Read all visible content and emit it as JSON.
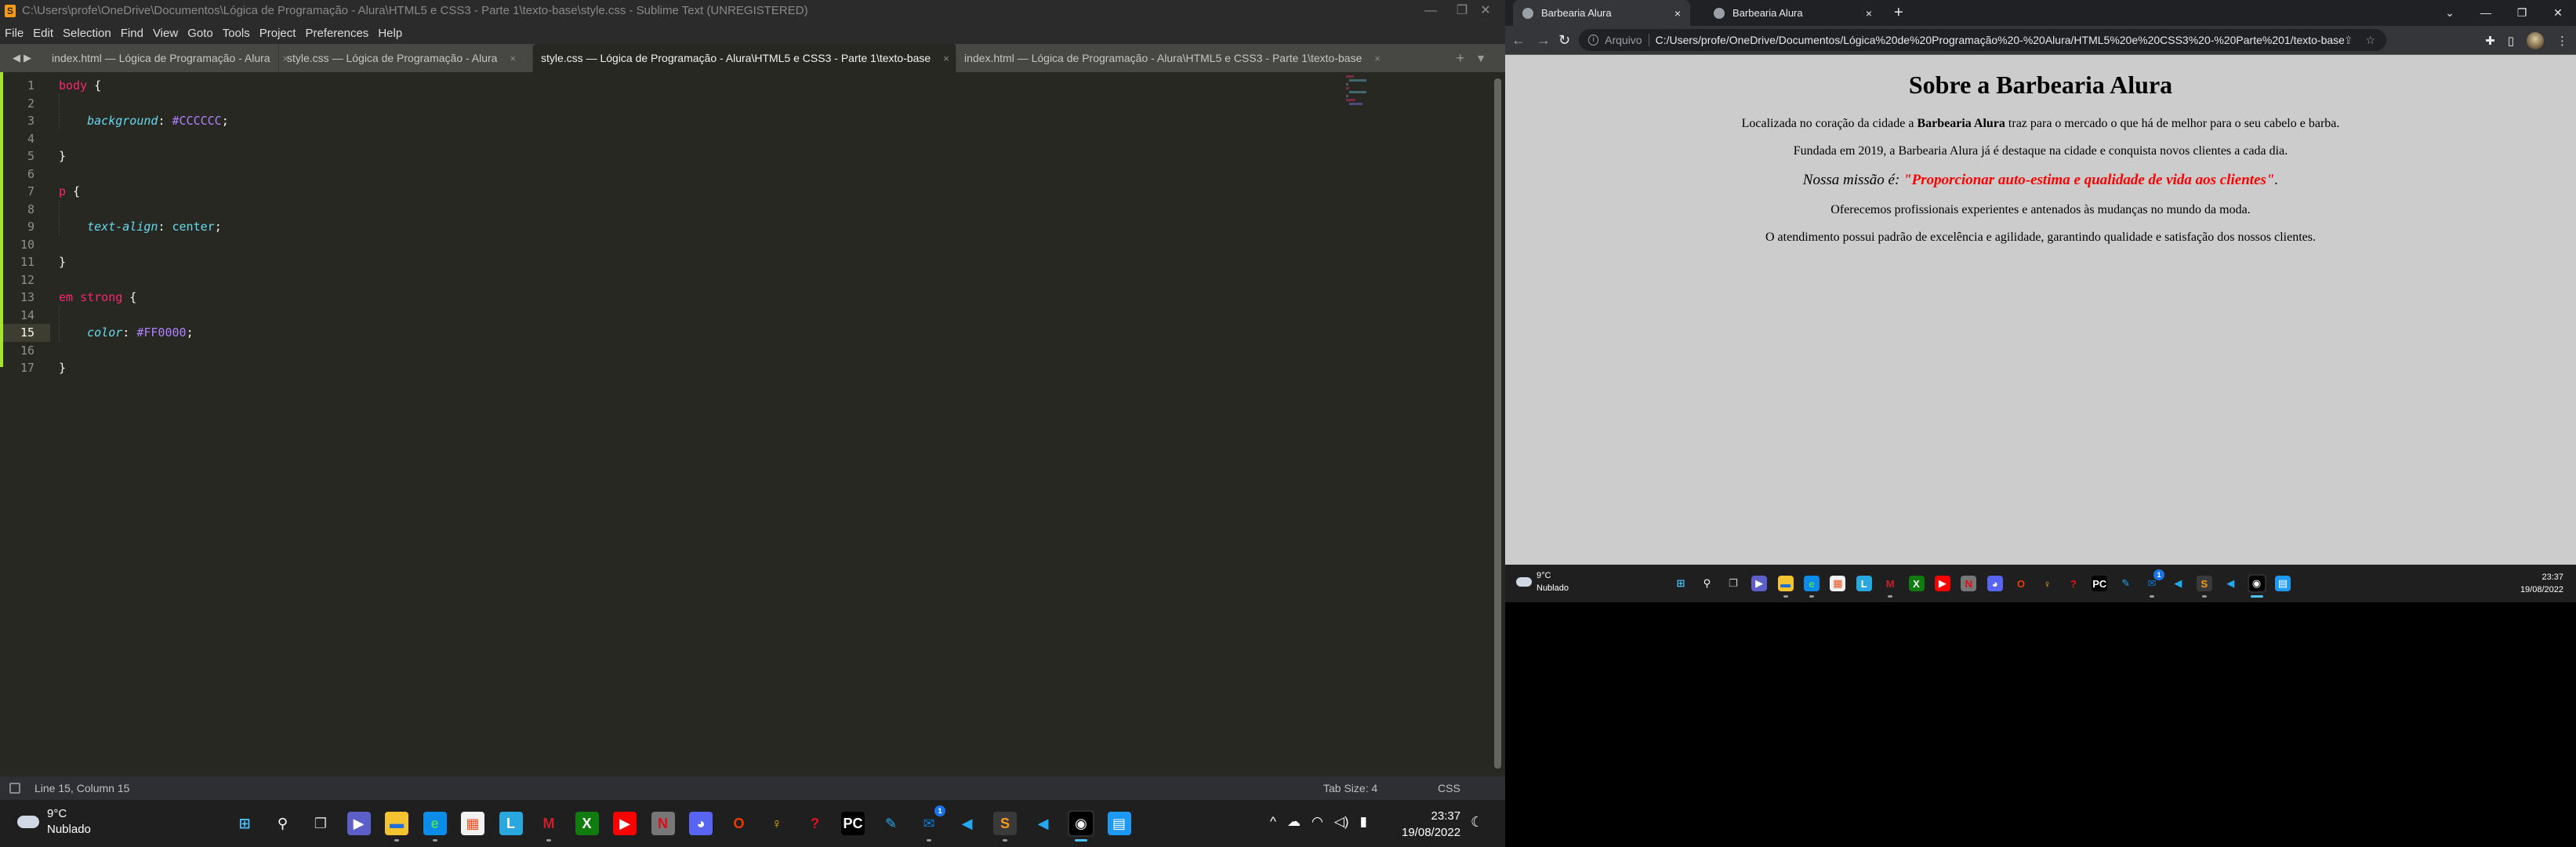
{
  "sublime": {
    "title": "C:\\Users\\profe\\OneDrive\\Documentos\\Lógica de Programação - Alura\\HTML5 e CSS3 - Parte 1\\texto-base\\style.css - Sublime Text (UNREGISTERED)",
    "menu": [
      "File",
      "Edit",
      "Selection",
      "Find",
      "View",
      "Goto",
      "Tools",
      "Project",
      "Preferences",
      "Help"
    ],
    "tabs": [
      {
        "label": "index.html — Lógica de Programação - Alura",
        "active": false
      },
      {
        "label": "style.css — Lógica de Programação - Alura",
        "active": false
      },
      {
        "label": "style.css — Lógica de Programação - Alura\\HTML5 e CSS3 - Parte 1\\texto-base",
        "active": true
      },
      {
        "label": "index.html — Lógica de Programação - Alura\\HTML5 e CSS3 - Parte 1\\texto-base",
        "active": false
      }
    ],
    "close_glyph": "×",
    "code": {
      "line_numbers": [
        "1",
        "2",
        "3",
        "4",
        "5",
        "6",
        "7",
        "8",
        "9",
        "10",
        "11",
        "12",
        "13",
        "14",
        "15",
        "16",
        "17"
      ],
      "current_line": 15,
      "l1_sel": "body",
      "l1_brace": " {",
      "l3_prop": "background",
      "l3_colon": ": ",
      "l3_val": "#CCCCCC",
      "l3_semi": ";",
      "l5": "}",
      "l7_sel": "p",
      "l7_brace": " {",
      "l9_prop": "text-align",
      "l9_colon": ": ",
      "l9_val": "center",
      "l9_semi": ";",
      "l11": "}",
      "l13_sel": "em strong",
      "l13_brace": " {",
      "l15_prop": "color",
      "l15_colon": ": ",
      "l15_val": "#FF0000",
      "l15_semi": ";",
      "l17": "}"
    },
    "status": {
      "position": "Line 15, Column 15",
      "tab_size": "Tab Size: 4",
      "syntax": "CSS"
    }
  },
  "browser": {
    "tabs": [
      {
        "label": "Barbearia Alura",
        "active": true
      },
      {
        "label": "Barbearia Alura",
        "active": false
      }
    ],
    "close_glyph": "×",
    "new_tab": "+",
    "address_label": "Arquivo",
    "url": "C:/Users/profe/OneDrive/Documentos/Lógica%20de%20Programação%20-%20Alura/HTML5%20e%20CSS3%20-%20Parte%201/texto-base/index.html",
    "page": {
      "heading": "Sobre a Barbearia Alura",
      "p1_before": "Localizada no coração da cidade a ",
      "p1_strong": "Barbearia Alura",
      "p1_after": " traz para o mercado o que há de melhor para o seu cabelo e barba.",
      "p2": "Fundada em 2019, a Barbearia Alura já é destaque na cidade e conquista novos clientes a cada dia.",
      "mission_em": "Nossa missão é: ",
      "mission_strong": "\"Proporcionar auto-estima e qualidade de vida aos clientes\"",
      "mission_end": ".",
      "p4": "Oferecemos profissionais experientes e antenados às mudanças no mundo da moda.",
      "p5": "O atendimento possui padrão de excelência e agilidade, garantindo qualidade e satisfação dos nossos clientes.",
      "background": "#CCCCCC",
      "accent": "#FF0000"
    }
  },
  "taskbar": {
    "weather_temp": "9°C",
    "weather_desc": "Nublado",
    "time": "23:37",
    "date": "19/08/2022",
    "apps": [
      {
        "name": "start",
        "glyph": "⊞",
        "bg": "transparent",
        "fg": "#4cc2ff"
      },
      {
        "name": "search",
        "glyph": "⚲",
        "bg": "transparent",
        "fg": "#ffffff"
      },
      {
        "name": "task-view",
        "glyph": "❐",
        "bg": "transparent",
        "fg": "#cccccc"
      },
      {
        "name": "teams-chat",
        "glyph": "▶",
        "bg": "#5b5fc7",
        "fg": "#ffffff"
      },
      {
        "name": "file-explorer",
        "glyph": "▬",
        "bg": "#f4c430",
        "fg": "#1e6fd9",
        "running": true
      },
      {
        "name": "edge",
        "glyph": "e",
        "bg": "#0c8ce9",
        "fg": "#4cd964",
        "running": true
      },
      {
        "name": "microsoft-store",
        "glyph": "▦",
        "bg": "#f2f2f2",
        "fg": "#f25022"
      },
      {
        "name": "lightshot",
        "glyph": "L",
        "bg": "#29a8e0",
        "fg": "#ffffff"
      },
      {
        "name": "mcafee",
        "glyph": "M",
        "bg": "transparent",
        "fg": "#c8202b",
        "running": true
      },
      {
        "name": "xbox",
        "glyph": "X",
        "bg": "#107c10",
        "fg": "#ffffff"
      },
      {
        "name": "youtube",
        "glyph": "▶",
        "bg": "#ff0000",
        "fg": "#ffffff"
      },
      {
        "name": "netflix",
        "glyph": "N",
        "bg": "#777777",
        "fg": "#e50914"
      },
      {
        "name": "discord",
        "glyph": "◕",
        "bg": "#5865f2",
        "fg": "#ffffff"
      },
      {
        "name": "office",
        "glyph": "O",
        "bg": "transparent",
        "fg": "#eb3c00"
      },
      {
        "name": "tips",
        "glyph": "♀",
        "bg": "transparent",
        "fg": "#f6b500"
      },
      {
        "name": "books-app",
        "glyph": "?",
        "bg": "transparent",
        "fg": "#e81123"
      },
      {
        "name": "pycharm",
        "glyph": "PC",
        "bg": "#000000",
        "fg": "#ffffff"
      },
      {
        "name": "paint",
        "glyph": "✎",
        "bg": "transparent",
        "fg": "#2aa8f2"
      },
      {
        "name": "mail",
        "glyph": "✉",
        "bg": "transparent",
        "fg": "#0f78d4",
        "running": true,
        "badge": "1"
      },
      {
        "name": "vscode",
        "glyph": "◀",
        "bg": "transparent",
        "fg": "#23a9f2"
      },
      {
        "name": "sublime-text",
        "glyph": "S",
        "bg": "#3a3a3a",
        "fg": "#f89b1d",
        "running": true
      },
      {
        "name": "vscode-2",
        "glyph": "◀",
        "bg": "transparent",
        "fg": "#23a9f2"
      },
      {
        "name": "chrome-incognito",
        "glyph": "◉",
        "bg": "#000000",
        "fg": "#ffffff",
        "active": true
      },
      {
        "name": "libreoffice-writer",
        "glyph": "▤",
        "bg": "#1d99f3",
        "fg": "#ffffff"
      }
    ],
    "tray": [
      "^",
      "☁",
      "◠",
      "◁)",
      "▮"
    ]
  }
}
